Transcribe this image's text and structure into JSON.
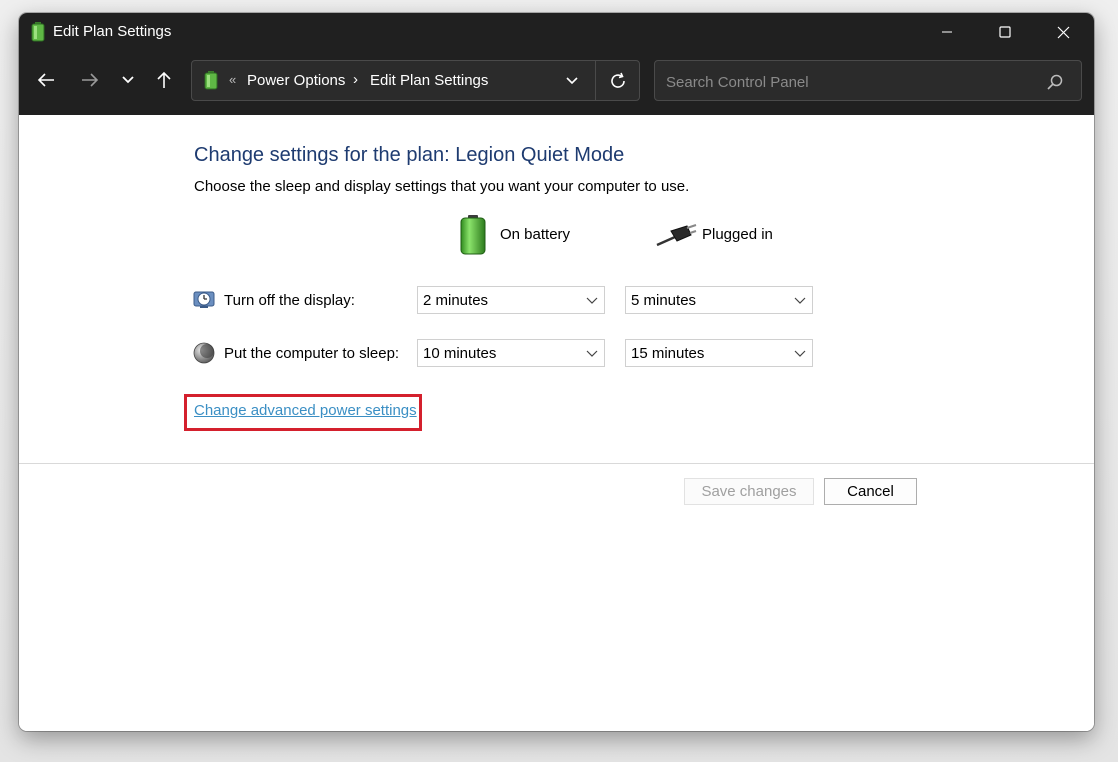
{
  "window": {
    "title": "Edit Plan Settings"
  },
  "toolbar": {
    "breadcrumb_prefix": "«",
    "breadcrumbs": [
      "Power Options",
      "Edit Plan Settings"
    ],
    "breadcrumb_separator": "›",
    "search_placeholder": "Search Control Panel"
  },
  "main": {
    "heading": "Change settings for the plan: Legion Quiet Mode",
    "subheading": "Choose the sleep and display settings that you want your computer to use.",
    "columns": {
      "on_battery": "On battery",
      "plugged_in": "Plugged in"
    },
    "rows": [
      {
        "label": "Turn off the display:",
        "on_battery": "2 minutes",
        "plugged_in": "5 minutes"
      },
      {
        "label": "Put the computer to sleep:",
        "on_battery": "10 minutes",
        "plugged_in": "15 minutes"
      }
    ],
    "advanced_link": "Change advanced power settings"
  },
  "footer": {
    "save_label": "Save changes",
    "cancel_label": "Cancel"
  },
  "colors": {
    "titlebar": "#202020",
    "heading": "#1e3b70",
    "link": "#3b8fc4",
    "highlight": "#d4202d"
  }
}
